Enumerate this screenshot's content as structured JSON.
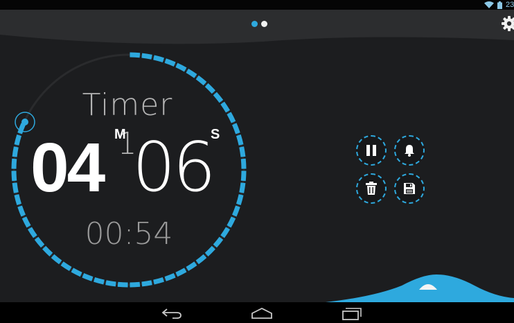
{
  "status_bar": {
    "time": "23",
    "icons": [
      "wifi-icon",
      "battery-icon"
    ]
  },
  "pager": {
    "pages": 2,
    "active_index": 0
  },
  "header": {
    "settings_icon": "gear-icon"
  },
  "timer": {
    "label": "Timer 1",
    "minutes": "04",
    "seconds": "06",
    "minutes_unit": "M",
    "seconds_unit": "S",
    "elapsed": "00:54",
    "progress_remaining": 0.81
  },
  "controls": [
    {
      "id": "pause",
      "icon": "pause-icon"
    },
    {
      "id": "alarm",
      "icon": "bell-icon"
    },
    {
      "id": "delete",
      "icon": "trash-icon"
    },
    {
      "id": "save",
      "icon": "save-icon"
    }
  ],
  "navigation": {
    "icons": [
      "back-icon",
      "home-icon",
      "recent-apps-icon"
    ]
  },
  "colors": {
    "accent": "#2ea9de",
    "background": "#1c1d1f",
    "header": "#2c2d2f"
  }
}
